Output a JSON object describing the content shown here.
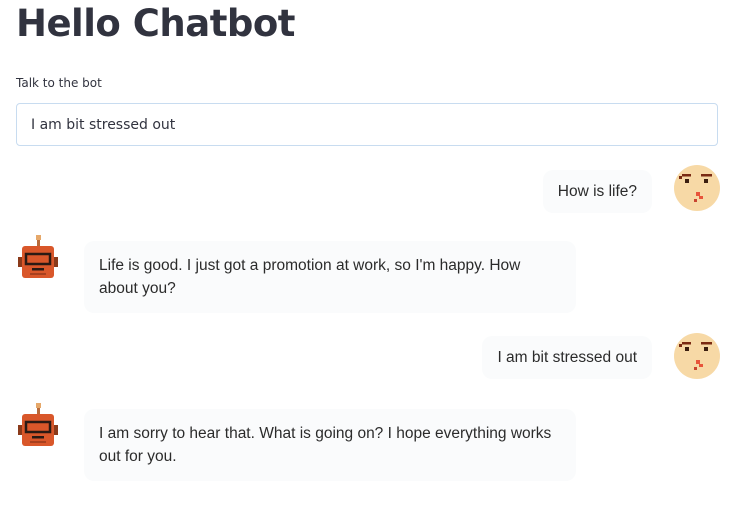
{
  "header": {
    "title": "Hello Chatbot"
  },
  "input": {
    "label": "Talk to the bot",
    "value": "I am bit stressed out"
  },
  "messages": [
    {
      "role": "user",
      "text": "How is life?"
    },
    {
      "role": "bot",
      "text": "Life is good. I just got a promotion at work, so I'm happy. How about you?"
    },
    {
      "role": "user",
      "text": "I am bit stressed out"
    },
    {
      "role": "bot",
      "text": "I am sorry to hear that. What is going on? I hope everything works out for you."
    }
  ],
  "avatars": {
    "user_icon": "face-avatar-icon",
    "bot_icon": "robot-avatar-icon"
  },
  "colors": {
    "title": "#31333f",
    "input_border": "#c8dcf0",
    "bubble_bg": "#fafbfc",
    "robot_body": "#d9572a",
    "face_skin": "#f7d9a6"
  }
}
